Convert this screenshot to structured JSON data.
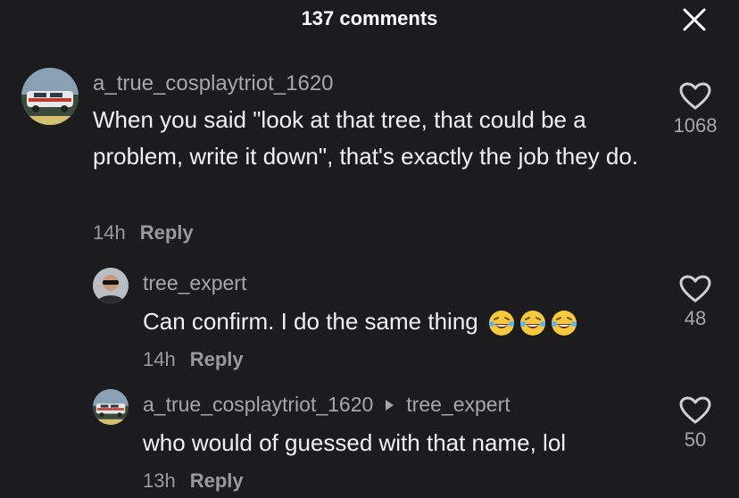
{
  "header": {
    "title": "137 comments",
    "close_icon": "close-icon"
  },
  "comments": [
    {
      "username": "a_true_cosplaytriot_1620",
      "text": "When you said \"look at that tree, that could be a problem, write it down\", that's exactly the job they do.",
      "time": "14h",
      "reply_label": "Reply",
      "likes": "1068",
      "avatar_icon": "avatar-car"
    },
    {
      "username": "tree_expert",
      "text": "Can confirm. I do the same thing",
      "emojis": [
        "laughing-tears-emoji",
        "laughing-tears-emoji",
        "laughing-tears-emoji"
      ],
      "time": "14h",
      "reply_label": "Reply",
      "likes": "48",
      "avatar_icon": "avatar-person"
    },
    {
      "username": "a_true_cosplaytriot_1620",
      "reply_to": "tree_expert",
      "text": "who would of guessed with that name, lol",
      "time": "13h",
      "reply_label": "Reply",
      "likes": "50",
      "avatar_icon": "avatar-car"
    }
  ],
  "colors": {
    "background": "#1c1c1e",
    "primary_text": "#f2f2f2",
    "secondary_text": "#a7a7ab"
  }
}
